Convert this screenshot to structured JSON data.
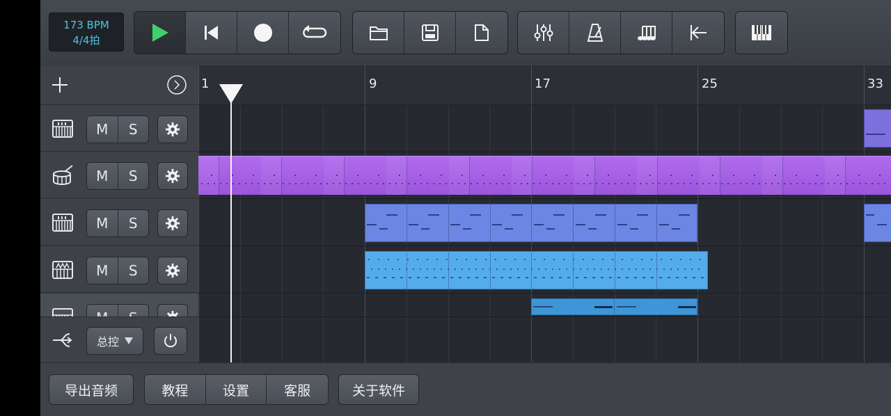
{
  "transport": {
    "tempo": "173 BPM",
    "time_signature": "4/4拍"
  },
  "toolbar": {
    "transport_buttons": [
      "play-icon",
      "skip-to-start-icon",
      "record-icon",
      "loop-icon"
    ],
    "file_buttons": [
      "open-folder-icon",
      "save-icon",
      "new-file-icon"
    ],
    "tool_buttons": [
      "mixer-icon",
      "metronome-icon",
      "music-note-icon",
      "return-to-start-icon"
    ],
    "piano_button": "piano-keys-icon"
  },
  "timeline": {
    "ruler_labels": [
      "1",
      "9",
      "17",
      "25",
      "33"
    ],
    "playhead_bar": 1.2
  },
  "tracks": [
    {
      "instrument_icon": "keyboard-icon",
      "mute_label": "M",
      "solo_label": "S",
      "settings_icon": "gear-icon",
      "clip_color": "#7f73e0"
    },
    {
      "instrument_icon": "drum-icon",
      "mute_label": "M",
      "solo_label": "S",
      "settings_icon": "gear-icon",
      "clip_color": "#a45ee6"
    },
    {
      "instrument_icon": "keyboard-icon",
      "mute_label": "M",
      "solo_label": "S",
      "settings_icon": "gear-icon",
      "clip_color": "#6e86e6"
    },
    {
      "instrument_icon": "synth-icon",
      "mute_label": "M",
      "solo_label": "S",
      "settings_icon": "gear-icon",
      "clip_color": "#4fa7e8"
    },
    {
      "instrument_icon": "keyboard-icon",
      "mute_label": "M",
      "solo_label": "S",
      "settings_icon": "gear-icon",
      "clip_color": "#3f95d8"
    }
  ],
  "master": {
    "select_label": "总控",
    "power_icon": "power-icon"
  },
  "bottom_bar": {
    "export_label": "导出音频",
    "tutorial_label": "教程",
    "settings_label": "设置",
    "support_label": "客服",
    "about_label": "关于软件"
  },
  "colors": {
    "accent": "#4fc3dc",
    "play_green": "#3fd16a"
  }
}
